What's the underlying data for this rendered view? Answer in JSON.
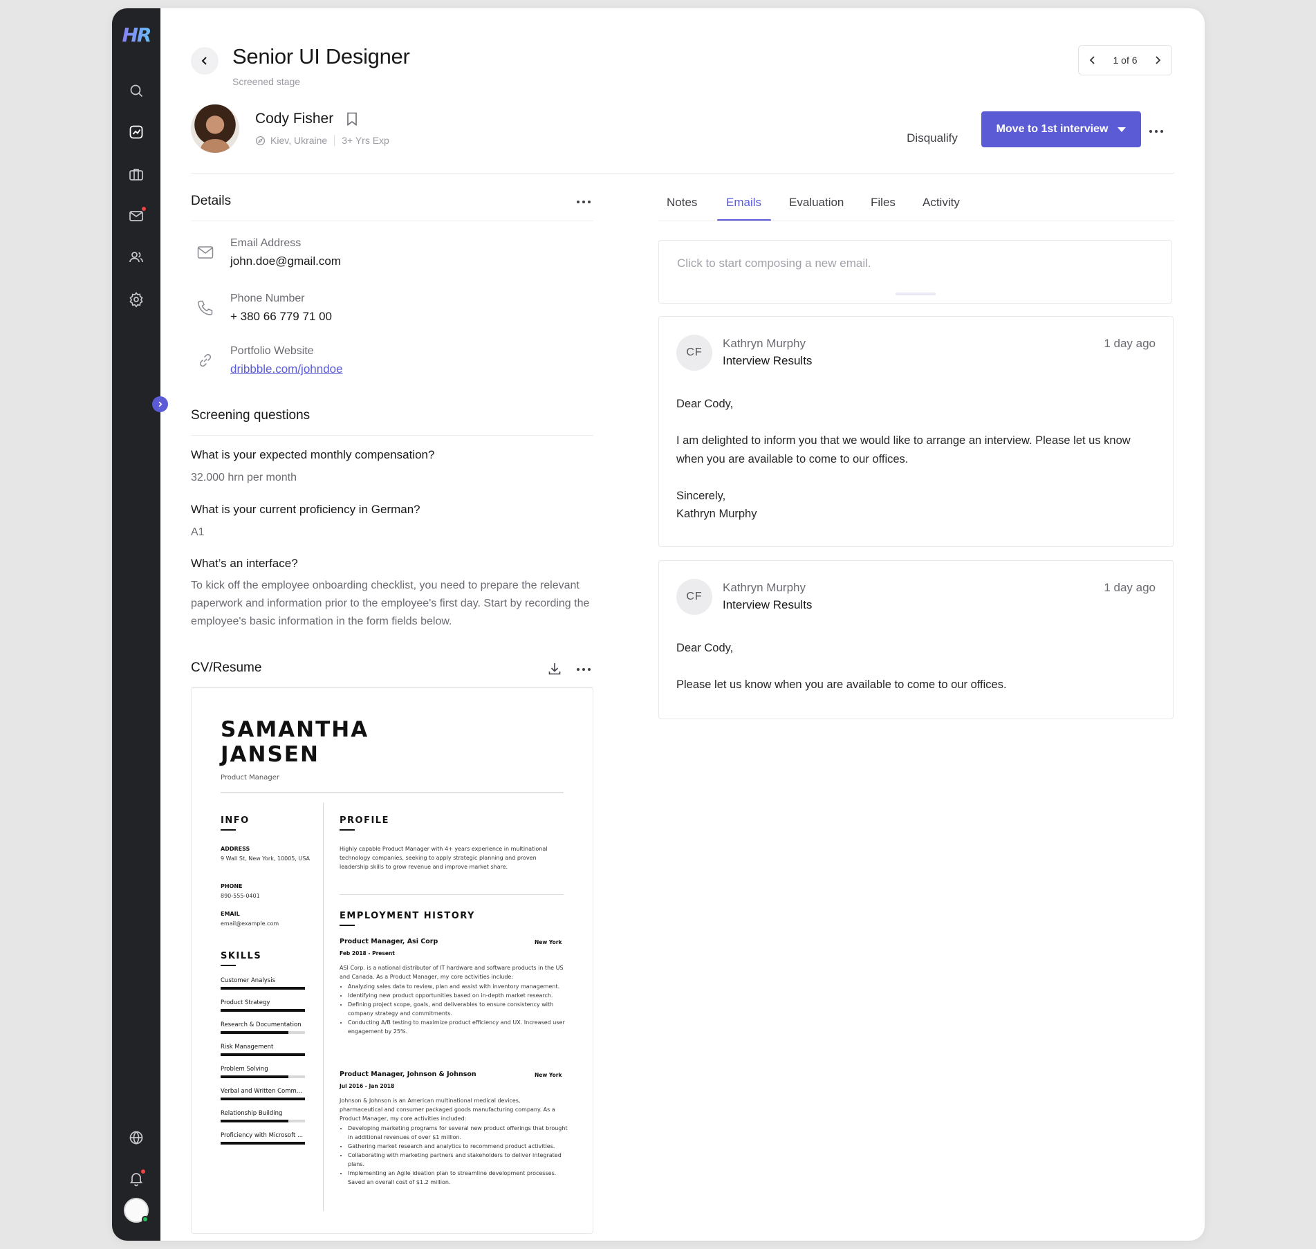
{
  "app": {
    "logo_text": "HR"
  },
  "sidebar": {
    "icons": [
      "search-icon",
      "analytics-icon",
      "briefcase-icon",
      "mail-icon",
      "users-icon",
      "settings-icon",
      "globe-icon",
      "bell-icon"
    ],
    "accent_color": "#5b5bd6",
    "notification_color": "#ef4444"
  },
  "header": {
    "job_title": "Senior UI Designer",
    "stage": "Screened stage",
    "pager": "1 of 6"
  },
  "candidate": {
    "name": "Cody Fisher",
    "location": "Kiev, Ukraine",
    "experience": "3+ Yrs Exp",
    "disqualify_label": "Disqualify",
    "move_label": "Move to 1st interview"
  },
  "details": {
    "title": "Details",
    "email_label": "Email Address",
    "email_value": "john.doe@gmail.com",
    "phone_label": "Phone Number",
    "phone_value": "+ 380 66 779 71 00",
    "portfolio_label": "Portfolio Website",
    "portfolio_value": "dribbble.com/johndoe"
  },
  "screening": {
    "title": "Screening questions",
    "items": [
      {
        "q": "What is your expected monthly compensation?",
        "a": "32.000 hrn per month"
      },
      {
        "q": "What is your current proficiency in German?",
        "a": "A1"
      },
      {
        "q": "What’s an interface?",
        "a": "To kick off the employee onboarding checklist, you need to prepare the relevant paperwork and information prior to the employee's first day. Start by recording the employee's basic information in the form fields below."
      }
    ]
  },
  "cv": {
    "title": "CV/Resume",
    "name_line1": "SAMANTHA",
    "name_line2": "JANSEN",
    "role": "Product Manager",
    "info_heading": "INFO",
    "address_label": "ADDRESS",
    "address_value": "9 Wall St, New York, 10005, USA",
    "phone_label": "PHONE",
    "phone_value": "890-555-0401",
    "email_label": "EMAIL",
    "email_value": "email@example.com",
    "skills_heading": "SKILLS",
    "skills": [
      {
        "name": "Customer Analysis",
        "level": 1.0
      },
      {
        "name": "Product Strategy",
        "level": 1.0
      },
      {
        "name": "Research & Documentation",
        "level": 0.8
      },
      {
        "name": "Risk Management",
        "level": 1.0
      },
      {
        "name": "Problem Solving",
        "level": 0.8
      },
      {
        "name": "Verbal and Written Comm...",
        "level": 1.0
      },
      {
        "name": "Relationship Building",
        "level": 0.8
      },
      {
        "name": "Proficiency with Microsoft ...",
        "level": 1.0
      }
    ],
    "profile_heading": "PROFILE",
    "profile_text": "Highly capable Product Manager with 4+ years experience in multinational technology companies, seeking to apply strategic planning and proven leadership skills to grow revenue and improve market share.",
    "employment_heading": "EMPLOYMENT HISTORY",
    "jobs": [
      {
        "title": "Product Manager, Asi Corp",
        "city": "New York",
        "dates": "Feb 2018 - Present",
        "intro": "ASI Corp. is a national distributor of IT hardware and software products in the US and Canada. As a Product Manager, my core activities include:",
        "bullets": [
          "Analyzing sales data to review, plan and assist with inventory management.",
          "Identifying new product opportunities based on in-depth market research.",
          "Defining project scope, goals, and deliverables to ensure consistency with company strategy and commitments.",
          "Conducting A/B testing to maximize product efficiency and UX. Increased user engagement by 25%."
        ]
      },
      {
        "title": "Product Manager, Johnson & Johnson",
        "city": "New York",
        "dates": "Jul 2016 - Jan 2018",
        "intro": "Johnson & Johnson is an American multinational medical devices, pharmaceutical and consumer packaged goods manufacturing company. As a Product Manager, my core activities included:",
        "bullets": [
          "Developing marketing programs for several new product offerings that brought in additional revenues of over $1 million.",
          "Gathering market research and analytics to recommend product activities.",
          "Collaborating with marketing partners and stakeholders to deliver integrated plans.",
          "Implementing an Agile ideation plan to streamline development processes. Saved an overall cost of $1.2 million."
        ]
      }
    ]
  },
  "tabs": [
    "Notes",
    "Emails",
    "Evaluation",
    "Files",
    "Activity"
  ],
  "active_tab": "Emails",
  "compose": {
    "placeholder": "Click to start composing a new email."
  },
  "emails": [
    {
      "initials": "CF",
      "from": "Kathryn Murphy",
      "subject": "Interview Results",
      "time": "1 day ago",
      "body": [
        "Dear Cody,",
        "I am delighted to inform you that we would like to arrange an interview. Please let us know when you are available to come to our offices.",
        "Sincerely,",
        "Kathryn Murphy"
      ]
    },
    {
      "initials": "CF",
      "from": "Kathryn Murphy",
      "subject": "Interview Results",
      "time": "1 day ago",
      "body": [
        "Dear Cody,",
        "Please let us know when you are available to come to our offices."
      ]
    }
  ]
}
